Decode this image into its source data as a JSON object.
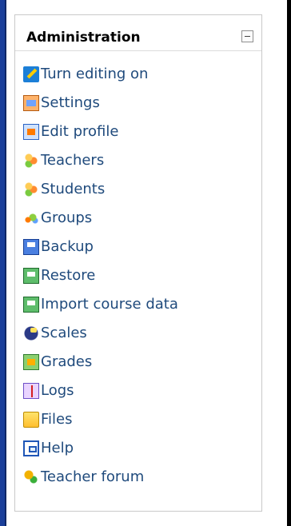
{
  "block": {
    "title": "Administration",
    "items": [
      {
        "label": "Turn editing on",
        "icon": "edit-icon"
      },
      {
        "label": "Settings",
        "icon": "settings-icon"
      },
      {
        "label": "Edit profile",
        "icon": "profile-icon"
      },
      {
        "label": "Teachers",
        "icon": "users-icon"
      },
      {
        "label": "Students",
        "icon": "users-icon"
      },
      {
        "label": "Groups",
        "icon": "groups-icon"
      },
      {
        "label": "Backup",
        "icon": "backup-icon"
      },
      {
        "label": "Restore",
        "icon": "restore-icon"
      },
      {
        "label": "Import course data",
        "icon": "import-icon"
      },
      {
        "label": "Scales",
        "icon": "scales-icon"
      },
      {
        "label": "Grades",
        "icon": "grades-icon"
      },
      {
        "label": "Logs",
        "icon": "logs-icon"
      },
      {
        "label": "Files",
        "icon": "folder-icon"
      },
      {
        "label": "Help",
        "icon": "help-icon"
      },
      {
        "label": "Teacher forum",
        "icon": "forum-icon"
      }
    ]
  }
}
